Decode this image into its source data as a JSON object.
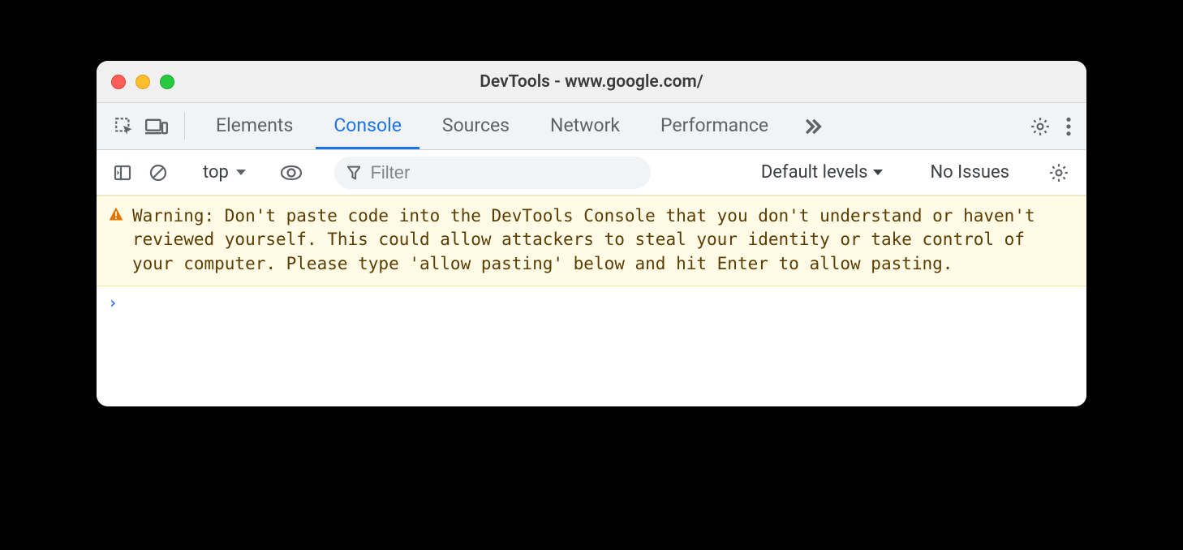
{
  "window": {
    "title": "DevTools - www.google.com/"
  },
  "tabs": {
    "items": [
      "Elements",
      "Console",
      "Sources",
      "Network",
      "Performance"
    ],
    "active_index": 1
  },
  "toolbar": {
    "context": "top",
    "filter_placeholder": "Filter",
    "levels_label": "Default levels",
    "issues_label": "No Issues"
  },
  "console": {
    "warning": "Warning: Don't paste code into the DevTools Console that you don't understand or haven't reviewed yourself. This could allow attackers to steal your identity or take control of your computer. Please type 'allow pasting' below and hit Enter to allow pasting."
  }
}
